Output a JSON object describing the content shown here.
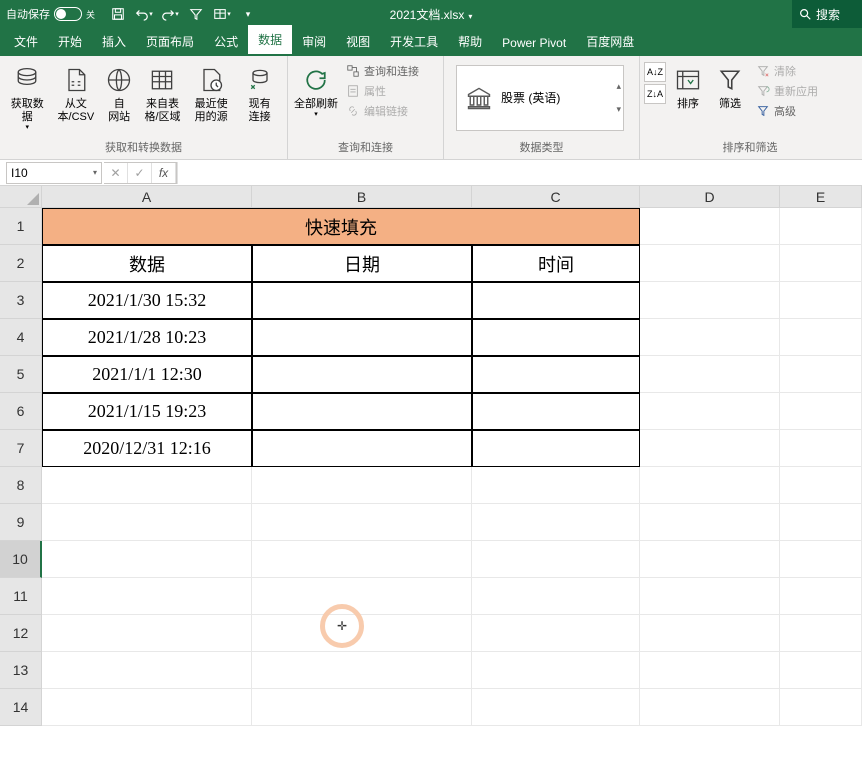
{
  "titlebar": {
    "autosave_label": "自动保存",
    "autosave_state": "关",
    "doc_title": "2021文档.xlsx",
    "search_placeholder": "搜索"
  },
  "tabs": [
    "文件",
    "开始",
    "插入",
    "页面布局",
    "公式",
    "数据",
    "审阅",
    "视图",
    "开发工具",
    "帮助",
    "Power Pivot",
    "百度网盘"
  ],
  "active_tab": "数据",
  "ribbon": {
    "group1": {
      "label": "获取和转换数据",
      "btns": [
        "获取数\n据",
        "从文\n本/CSV",
        "自\n网站",
        "来自表\n格/区域",
        "最近使\n用的源",
        "现有\n连接"
      ]
    },
    "group2": {
      "label": "查询和连接",
      "main": "全部刷新",
      "items": [
        "查询和连接",
        "属性",
        "编辑链接"
      ]
    },
    "group3": {
      "label": "数据类型",
      "stock": "股票 (英语)"
    },
    "group4": {
      "label": "排序和筛选",
      "sort": "排序",
      "filter": "筛选",
      "items": [
        "清除",
        "重新应用",
        "高级"
      ]
    }
  },
  "formula_bar": {
    "name_box": "I10",
    "formula": ""
  },
  "grid": {
    "columns": [
      "A",
      "B",
      "C",
      "D",
      "E"
    ],
    "row_count": 14,
    "title_merged": "快速填充",
    "headers": [
      "数据",
      "日期",
      "时间"
    ],
    "data_rows": [
      {
        "a": "2021/1/30 15:32",
        "b": "",
        "c": ""
      },
      {
        "a": "2021/1/28 10:23",
        "b": "",
        "c": ""
      },
      {
        "a": "2021/1/1 12:30",
        "b": "",
        "c": ""
      },
      {
        "a": "2021/1/15 19:23",
        "b": "",
        "c": ""
      },
      {
        "a": "2020/12/31 12:16",
        "b": "",
        "c": ""
      }
    ],
    "selected_row": 10
  }
}
